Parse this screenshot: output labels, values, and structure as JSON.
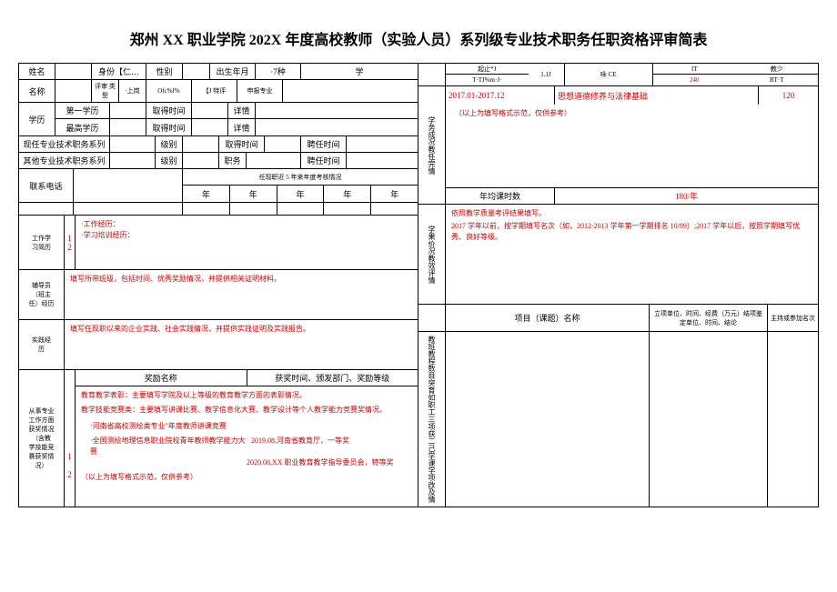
{
  "title": "郑州 XX 职业学院 202X 年度高校教师（实验人员）系列级专业技术职务任职资格评审简表",
  "left": {
    "r1": {
      "l1": "姓名",
      "l2": "身份【仁…",
      "l3": "性别",
      "l4": "出生年月",
      "v4": "·7种",
      "l5": "学"
    },
    "r2": {
      "l1": "名称",
      "l2": "评审\n类型",
      "v2": "·上岗",
      "l3": "Ofc%f%",
      "l4": "【J 特评",
      "l5": "申报专业"
    },
    "edu": {
      "groupLabel": "学历",
      "first": {
        "l": "第一学历",
        "t": "取得时间",
        "d": "详情"
      },
      "top": {
        "l": "最高学历",
        "t": "取得时间",
        "d": "详情"
      }
    },
    "prof1": {
      "l": "现任专业技术职务系列",
      "lv": "级别",
      "tm": "取得时间",
      "pr": "聘任时间"
    },
    "prof2": {
      "l": "其他专业技术职务系列",
      "lv": "级别",
      "jb": "职务",
      "pr": "聘任时间"
    },
    "phone": "联系电话",
    "eval5y": "任现职近 5 年来年度考核情况",
    "yearHdr": "年",
    "work": {
      "label": "工作学\n习简历",
      "n1": "1",
      "n2": "2",
      "t1": "·工作经历：",
      "t2": "·学习培训经历："
    },
    "tutor": {
      "label": "辅导员\n（班主\n任）经历",
      "text": "填写所带班级，包括时间、优秀奖励情况，并提供相关证明材料。"
    },
    "practice": {
      "label": "实践经\n历",
      "text": "填写任现职以来的企业实践、社会实践情况，并提供实践证明及实践报告。"
    },
    "awards": {
      "label": "从事专业\n工作方面\n获奖情况\n（含教\n学技能竞\n赛获奖情\n况）",
      "hdr1": "奖励名称",
      "hdr2": "获奖时间、颁发部门、奖励等级",
      "line1": "教育教学表彰：主要填写学院及以上等级的教育教学方面的表彰情况。",
      "line2": "教学技能竞赛类：主要填写讲课比赛、教学信息化大赛、教学设计等个人教学能力竞赛奖情况。",
      "n1": "1",
      "n2": "2",
      "c1": "·河南省高校测绘类专业\"年度教师讲课竞赛",
      "c2a": "·全国测绘地理信息职业院校青年教师教学能力大赛",
      "c2b": "2019.08,河南省教育厅，一等奖",
      "c2c": "2020.08,XX 职业教育教学指导委员会，特等奖",
      "note": "（以上为填写格式示范，仅供参考）"
    }
  },
  "right": {
    "topHdr": {
      "c1": "起止*J",
      "c1b": "T·TJ%m·J·",
      "c2": "1.1J",
      "c3": "咏     CE",
      "c4": "IT",
      "c4b": "240",
      "c5": "教少",
      "c5b": "BT·T"
    },
    "teachSideLabel": "学务成况教任完情",
    "teach1": {
      "time": "2017.01-2017.12",
      "course": "思想道德修养与法律基础",
      "hours": "120"
    },
    "teachNote": "（以上为填写格式示范，仅供参考）",
    "avgLabel": "年均课时数",
    "avgVal": "180/年",
    "qualitySideLabel": "学果价况教效评情",
    "qualityLine1": "依照教学质量考评结果填写。",
    "qualityLine2": "2017 学年以前，按学期填写名次（如，2012-2013 学年第一学期排名 10/89）;2017 学年以后，按照学期填写优秀、良好等级。",
    "proj": {
      "h1": "项目（课题）名称",
      "h2": "立项单位、时间、经费（万元）结项鉴定单位、时间、结论",
      "h3": "主持或参加名次"
    },
    "projSideLabel": "教班教程数目突育如职工三项获二己学课学项改及情"
  }
}
